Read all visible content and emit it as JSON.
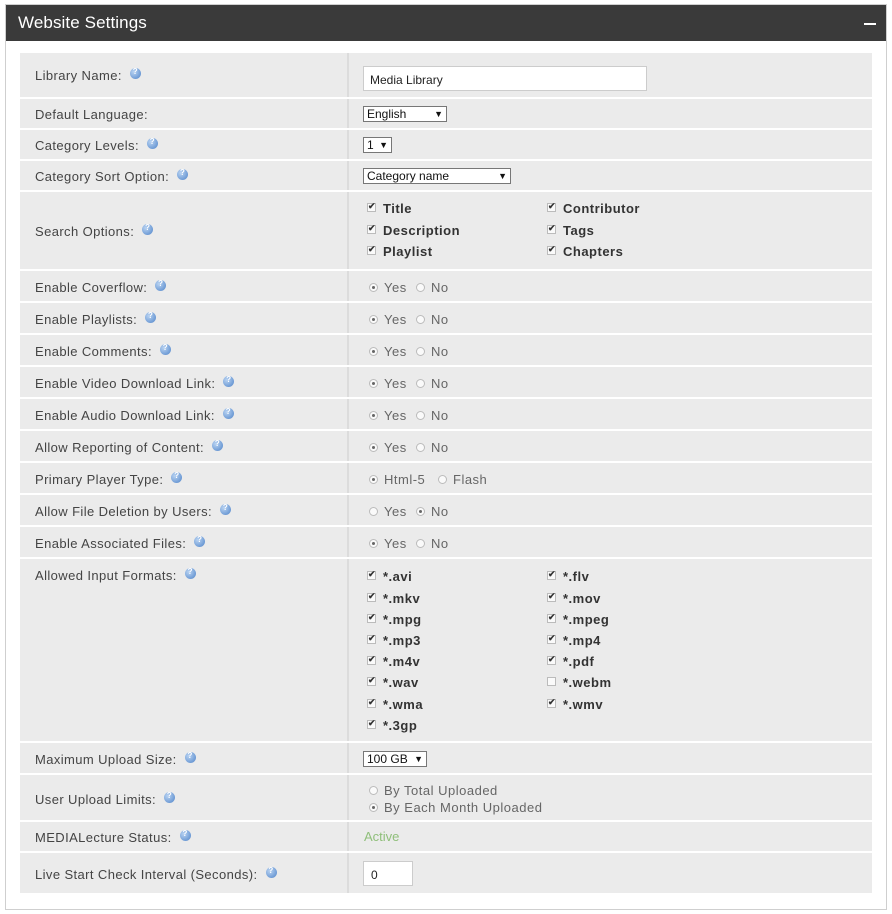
{
  "panel": {
    "title": "Website Settings"
  },
  "rows": {
    "library_name": {
      "label": "Library Name:",
      "value": "Media Library"
    },
    "default_language": {
      "label": "Default Language:",
      "value": "English"
    },
    "category_levels": {
      "label": "Category Levels:",
      "value": "1"
    },
    "category_sort": {
      "label": "Category Sort Option:",
      "value": "Category name"
    },
    "search_options": {
      "label": "Search Options:",
      "items": [
        {
          "label": "Title",
          "checked": true
        },
        {
          "label": "Contributor",
          "checked": true
        },
        {
          "label": "Description",
          "checked": true
        },
        {
          "label": "Tags",
          "checked": true
        },
        {
          "label": "Playlist",
          "checked": true
        },
        {
          "label": "Chapters",
          "checked": true
        }
      ]
    },
    "coverflow": {
      "label": "Enable Coverflow:",
      "yes": "Yes",
      "no": "No",
      "selected": "yes"
    },
    "playlists": {
      "label": "Enable Playlists:",
      "yes": "Yes",
      "no": "No",
      "selected": "yes"
    },
    "comments": {
      "label": "Enable Comments:",
      "yes": "Yes",
      "no": "No",
      "selected": "yes"
    },
    "video_download": {
      "label": "Enable Video Download Link:",
      "yes": "Yes",
      "no": "No",
      "selected": "yes"
    },
    "audio_download": {
      "label": "Enable Audio Download Link:",
      "yes": "Yes",
      "no": "No",
      "selected": "yes"
    },
    "reporting": {
      "label": "Allow Reporting of Content:",
      "yes": "Yes",
      "no": "No",
      "selected": "yes"
    },
    "player_type": {
      "label": "Primary Player Type:",
      "yes": "Html-5",
      "no": "Flash",
      "selected": "yes"
    },
    "file_deletion": {
      "label": "Allow File Deletion by Users:",
      "yes": "Yes",
      "no": "No",
      "selected": "no"
    },
    "associated_files": {
      "label": "Enable Associated Files:",
      "yes": "Yes",
      "no": "No",
      "selected": "yes"
    },
    "input_formats": {
      "label": "Allowed Input Formats:",
      "items": [
        {
          "label": "*.avi",
          "checked": true
        },
        {
          "label": "*.flv",
          "checked": true
        },
        {
          "label": "*.mkv",
          "checked": true
        },
        {
          "label": "*.mov",
          "checked": true
        },
        {
          "label": "*.mpg",
          "checked": true
        },
        {
          "label": "*.mpeg",
          "checked": true
        },
        {
          "label": "*.mp3",
          "checked": true
        },
        {
          "label": "*.mp4",
          "checked": true
        },
        {
          "label": "*.m4v",
          "checked": true
        },
        {
          "label": "*.pdf",
          "checked": true
        },
        {
          "label": "*.wav",
          "checked": true
        },
        {
          "label": "*.webm",
          "checked": false
        },
        {
          "label": "*.wma",
          "checked": true
        },
        {
          "label": "*.wmv",
          "checked": true
        },
        {
          "label": "*.3gp",
          "checked": true
        }
      ]
    },
    "max_upload": {
      "label": "Maximum Upload Size:",
      "value": "100 GB"
    },
    "upload_limits": {
      "label": "User Upload Limits:",
      "options": [
        {
          "label": "By Total Uploaded",
          "selected": false
        },
        {
          "label": "By Each Month Uploaded",
          "selected": true
        }
      ]
    },
    "medialecture": {
      "label": "MEDIALecture Status:",
      "value": "Active"
    },
    "live_check": {
      "label": "Live Start Check Interval (Seconds):",
      "value": "0"
    }
  },
  "colors": {
    "header_bg": "#3a3a3a",
    "status_active": "#8fbf7a",
    "help_icon": "#4f84c9"
  }
}
